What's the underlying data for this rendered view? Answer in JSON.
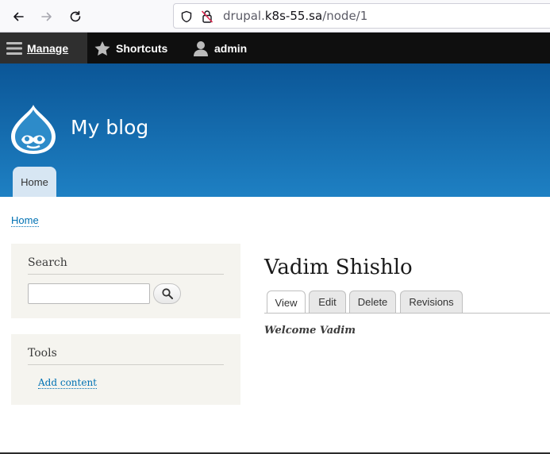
{
  "browser": {
    "url_prefix": "drupal.",
    "url_host": "k8s-55.sa",
    "url_path": "/node/1",
    "icons": [
      "back-icon",
      "forward-icon",
      "reload-icon",
      "shield-icon",
      "insecure-lock-icon"
    ]
  },
  "toolbar": {
    "manage_label": "Manage",
    "shortcuts_label": "Shortcuts",
    "user_label": "admin"
  },
  "header": {
    "site_name": "My blog",
    "primary_tab": "Home"
  },
  "breadcrumb": {
    "home_label": "Home"
  },
  "sidebar": {
    "search_title": "Search",
    "search_value": "",
    "tools_title": "Tools",
    "tools_link": "Add content"
  },
  "node": {
    "title": "Vadim Shishlo",
    "tabs": [
      "View",
      "Edit",
      "Delete",
      "Revisions"
    ],
    "active_tab": "View",
    "body": "Welcome Vadim"
  },
  "colors": {
    "header_top": "#0b5697",
    "header_bottom": "#1e80c3",
    "toolbar_bg": "#0f0f0f",
    "link": "#0071b3",
    "sidebar_block_bg": "#f5f4ef"
  }
}
